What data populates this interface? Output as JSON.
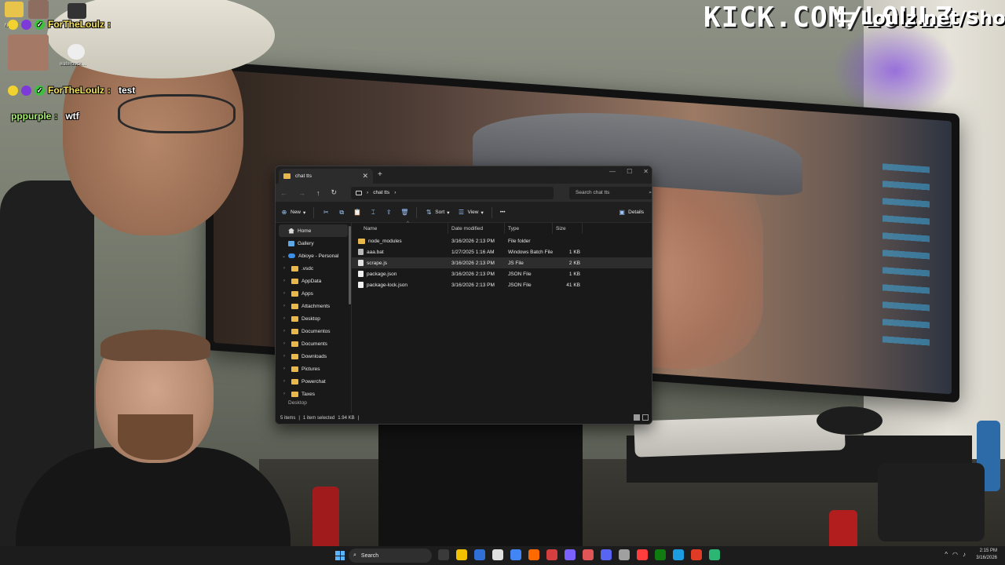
{
  "overlay": {
    "kick_brand": "KICK.COM/LOULZ",
    "shop_brand": "Loulz.net/Shop"
  },
  "chat": {
    "mini_labels": [
      "N…er",
      "waterbuck…"
    ],
    "messages": [
      {
        "user": "ForTheLoulz",
        "text": "",
        "user_color": "#f5e35a"
      },
      {
        "user": "ForTheLoulz",
        "text": "test",
        "user_color": "#f5e35a"
      },
      {
        "user": "pppurple",
        "text": "wtf",
        "user_color": "#a6f06b"
      }
    ]
  },
  "explorer": {
    "tab_title": "chat tts",
    "address_path": "chat tts",
    "search_placeholder": "Search chat tts",
    "toolbar": {
      "new": "New",
      "sort": "Sort",
      "view": "View",
      "more": "•••",
      "details": "Details"
    },
    "nav": {
      "home": "Home",
      "gallery": "Gallery",
      "onedrive": "Abioye - Personal",
      "folders": [
        ".vsdc",
        "AppData",
        "Apps",
        "Attachments",
        "Desktop",
        "Documentos",
        "Documents",
        "Downloads",
        "Pictures",
        "Powerchat",
        "Taxes"
      ],
      "partial": "Desktop"
    },
    "columns": {
      "name": "Name",
      "date": "Date modified",
      "type": "Type",
      "size": "Size"
    },
    "files": [
      {
        "name": "node_modules",
        "date": "3/16/2026 2:13 PM",
        "type": "File folder",
        "size": "",
        "kind": "folder"
      },
      {
        "name": "aaa.bat",
        "date": "1/27/2025 1:16 AM",
        "type": "Windows Batch File",
        "size": "1 KB",
        "kind": "bat"
      },
      {
        "name": "scrape.js",
        "date": "3/16/2026 2:13 PM",
        "type": "JS File",
        "size": "2 KB",
        "kind": "js"
      },
      {
        "name": "package.json",
        "date": "3/16/2026 2:13 PM",
        "type": "JSON File",
        "size": "1 KB",
        "kind": "json"
      },
      {
        "name": "package-lock.json",
        "date": "3/16/2026 2:13 PM",
        "type": "JSON File",
        "size": "41 KB",
        "kind": "json"
      }
    ],
    "selected_file_index": 2,
    "status": {
      "items": "5 items",
      "selection": "1 item selected",
      "size": "1.94 KB"
    }
  },
  "taskbar": {
    "search_placeholder": "Search",
    "time": "2:15 PM",
    "date": "3/16/2026",
    "icon_colors": [
      "#3a3a3a",
      "#f2c200",
      "#2f6fd6",
      "#e0e0e0",
      "#4285f4",
      "#ff6a00",
      "#d43e3e",
      "#7b61ff",
      "#e05555",
      "#5865f2",
      "#a0a0a0",
      "#ff3d3d",
      "#107c10",
      "#1b9be0",
      "#e03b24",
      "#2bb673"
    ]
  }
}
